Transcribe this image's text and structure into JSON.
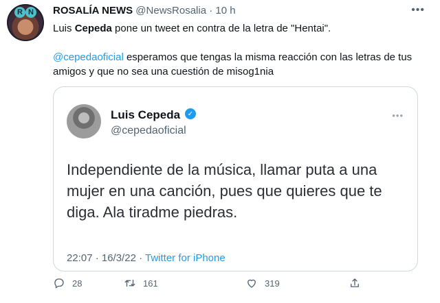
{
  "tweet": {
    "author_name": "ROSALÍA NEWS",
    "author_handle": "@NewsRosalia",
    "separator": "·",
    "time": "10 h",
    "avatar_letters": [
      "R",
      "N"
    ],
    "text_line1_before": "Luis ",
    "text_line1_bold": "Cepeda",
    "text_line1_after": " pone un tweet en contra de la letra de \"Hentai\".",
    "mention": "@cepedaoficial",
    "text_line2": " esperamos que tengas la misma reacción con las letras de tus amigos y que no sea una cuestión de misog1nia"
  },
  "quoted": {
    "name": "Luis Cepeda",
    "handle": "@cepedaoficial",
    "text": "Independiente de la música, llamar puta a una mujer en una canción, pues que quieres que te diga. Ala tiradme piedras.",
    "timestamp": "22:07 · 16/3/22 · ",
    "source": "Twitter for iPhone"
  },
  "actions": {
    "replies": "28",
    "retweets": "161",
    "likes": "319"
  }
}
